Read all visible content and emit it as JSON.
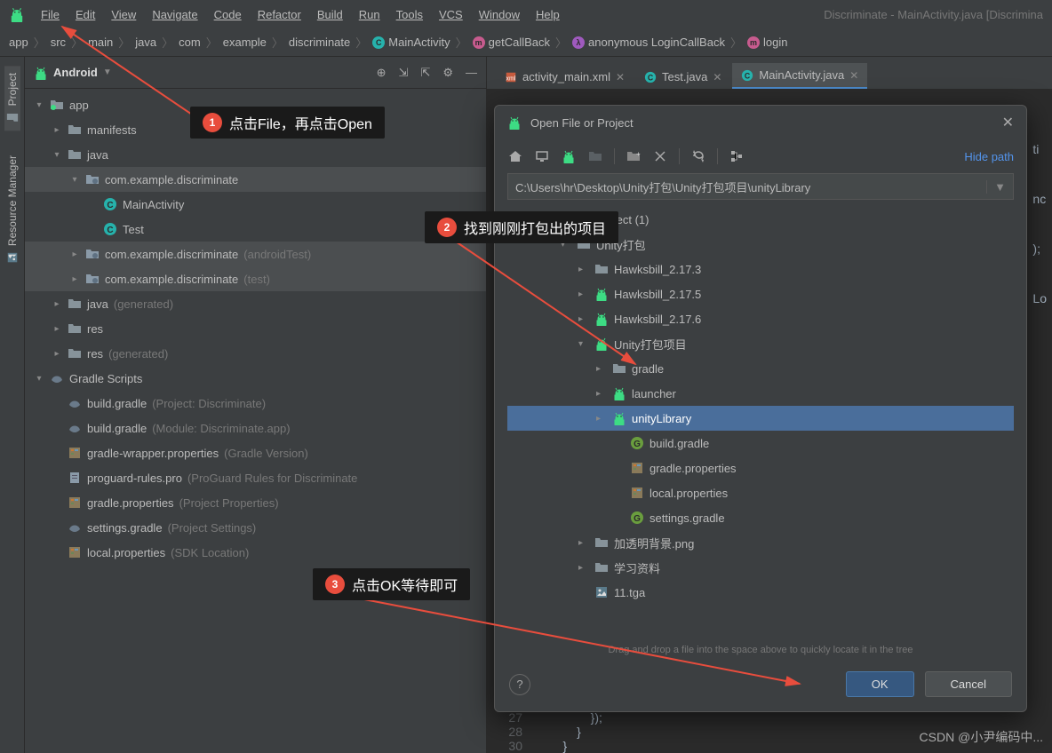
{
  "window": {
    "title": "Discriminate - MainActivity.java [Discrimina"
  },
  "menu": {
    "file": "File",
    "edit": "Edit",
    "view": "View",
    "navigate": "Navigate",
    "code": "Code",
    "refactor": "Refactor",
    "build": "Build",
    "run": "Run",
    "tools": "Tools",
    "vcs": "VCS",
    "window": "Window",
    "help": "Help"
  },
  "breadcrumb": [
    "app",
    "src",
    "main",
    "java",
    "com",
    "example",
    "discriminate",
    "MainActivity",
    "getCallBack",
    "anonymous LoginCallBack",
    "login"
  ],
  "side_tabs": {
    "project": "Project",
    "resource_manager": "Resource Manager"
  },
  "panel": {
    "label": "Android"
  },
  "tree": [
    {
      "indent": 0,
      "arrow": "▾",
      "icon": "module",
      "label": "app",
      "note": "",
      "hl": false
    },
    {
      "indent": 1,
      "arrow": "▸",
      "icon": "folder",
      "label": "manifests",
      "note": "",
      "hl": false
    },
    {
      "indent": 1,
      "arrow": "▾",
      "icon": "folder",
      "label": "java",
      "note": "",
      "hl": false
    },
    {
      "indent": 2,
      "arrow": "▾",
      "icon": "package",
      "label": "com.example.discriminate",
      "note": "",
      "hl": true
    },
    {
      "indent": 3,
      "arrow": "",
      "icon": "class",
      "label": "MainActivity",
      "note": "",
      "hl": false
    },
    {
      "indent": 3,
      "arrow": "",
      "icon": "class",
      "label": "Test",
      "note": "",
      "hl": false
    },
    {
      "indent": 2,
      "arrow": "▸",
      "icon": "package",
      "label": "com.example.discriminate",
      "note": "(androidTest)",
      "hl": true
    },
    {
      "indent": 2,
      "arrow": "▸",
      "icon": "package",
      "label": "com.example.discriminate",
      "note": "(test)",
      "hl": true
    },
    {
      "indent": 1,
      "arrow": "▸",
      "icon": "genfolder",
      "label": "java",
      "note": "(generated)",
      "hl": false
    },
    {
      "indent": 1,
      "arrow": "▸",
      "icon": "resfolder",
      "label": "res",
      "note": "",
      "hl": false
    },
    {
      "indent": 1,
      "arrow": "▸",
      "icon": "resfolder",
      "label": "res",
      "note": "(generated)",
      "hl": false
    },
    {
      "indent": 0,
      "arrow": "▾",
      "icon": "gradle",
      "label": "Gradle Scripts",
      "note": "",
      "hl": false
    },
    {
      "indent": 1,
      "arrow": "",
      "icon": "gradlefile",
      "label": "build.gradle",
      "note": "(Project: Discriminate)",
      "hl": false
    },
    {
      "indent": 1,
      "arrow": "",
      "icon": "gradlefile",
      "label": "build.gradle",
      "note": "(Module: Discriminate.app)",
      "hl": false
    },
    {
      "indent": 1,
      "arrow": "",
      "icon": "propfile",
      "label": "gradle-wrapper.properties",
      "note": "(Gradle Version)",
      "hl": false
    },
    {
      "indent": 1,
      "arrow": "",
      "icon": "textfile",
      "label": "proguard-rules.pro",
      "note": "(ProGuard Rules for Discriminate",
      "hl": false
    },
    {
      "indent": 1,
      "arrow": "",
      "icon": "propfile",
      "label": "gradle.properties",
      "note": "(Project Properties)",
      "hl": false
    },
    {
      "indent": 1,
      "arrow": "",
      "icon": "gradlefile",
      "label": "settings.gradle",
      "note": "(Project Settings)",
      "hl": false
    },
    {
      "indent": 1,
      "arrow": "",
      "icon": "propfile",
      "label": "local.properties",
      "note": "(SDK Location)",
      "hl": false
    }
  ],
  "editor_tabs": [
    {
      "label": "activity_main.xml",
      "icon": "xml",
      "active": false
    },
    {
      "label": "Test.java",
      "icon": "class",
      "active": false
    },
    {
      "label": "MainActivity.java",
      "icon": "class",
      "active": true
    }
  ],
  "editor_lines": [
    {
      "no": "",
      "code": "ti"
    },
    {
      "no": "",
      "code": ""
    },
    {
      "no": "",
      "code": "nc"
    },
    {
      "no": "",
      "code": ""
    },
    {
      "no": "",
      "code": ");"
    },
    {
      "no": "",
      "code": ""
    },
    {
      "no": "",
      "code": ""
    },
    {
      "no": "",
      "code": "Lo"
    },
    {
      "no": "27",
      "code": "            });"
    },
    {
      "no": "28",
      "code": "        }"
    },
    {
      "no": "30",
      "code": "    }"
    }
  ],
  "dialog": {
    "title": "Open File or Project",
    "hide_path": "Hide path",
    "path": "C:\\Users\\hr\\Desktop\\Unity打包\\Unity打包项目\\unityLibrary",
    "hint": "Drag and drop a file into the space above to quickly locate it in the tree",
    "ok": "OK",
    "cancel": "Cancel",
    "tree": [
      {
        "indent": 0,
        "arrow": "▾",
        "icon": "folder",
        "label": "My project (1)",
        "sel": false
      },
      {
        "indent": 1,
        "arrow": "▾",
        "icon": "folder",
        "label": "Unity打包",
        "sel": false
      },
      {
        "indent": 2,
        "arrow": "▸",
        "icon": "folder",
        "label": "Hawksbill_2.17.3",
        "sel": false
      },
      {
        "indent": 2,
        "arrow": "▸",
        "icon": "android",
        "label": "Hawksbill_2.17.5",
        "sel": false
      },
      {
        "indent": 2,
        "arrow": "▸",
        "icon": "android",
        "label": "Hawksbill_2.17.6",
        "sel": false
      },
      {
        "indent": 2,
        "arrow": "▾",
        "icon": "android",
        "label": "Unity打包项目",
        "sel": false
      },
      {
        "indent": 3,
        "arrow": "▸",
        "icon": "folder",
        "label": "gradle",
        "sel": false
      },
      {
        "indent": 3,
        "arrow": "▸",
        "icon": "android",
        "label": "launcher",
        "sel": false
      },
      {
        "indent": 3,
        "arrow": "▸",
        "icon": "android",
        "label": "unityLibrary",
        "sel": true
      },
      {
        "indent": 4,
        "arrow": "",
        "icon": "gcircle",
        "label": "build.gradle",
        "sel": false
      },
      {
        "indent": 4,
        "arrow": "",
        "icon": "propfile",
        "label": "gradle.properties",
        "sel": false
      },
      {
        "indent": 4,
        "arrow": "",
        "icon": "propfile",
        "label": "local.properties",
        "sel": false
      },
      {
        "indent": 4,
        "arrow": "",
        "icon": "gcircle",
        "label": "settings.gradle",
        "sel": false
      },
      {
        "indent": 2,
        "arrow": "▸",
        "icon": "folder",
        "label": "加透明背景.png",
        "sel": false
      },
      {
        "indent": 2,
        "arrow": "▸",
        "icon": "folder",
        "label": "学习资料",
        "sel": false
      },
      {
        "indent": 2,
        "arrow": "",
        "icon": "imgfile",
        "label": "11.tga",
        "sel": false
      }
    ]
  },
  "callouts": {
    "c1": {
      "num": "1",
      "text": "点击File，再点击Open"
    },
    "c2": {
      "num": "2",
      "text": "找到刚刚打包出的项目"
    },
    "c3": {
      "num": "3",
      "text": "点击OK等待即可"
    }
  },
  "watermark": "CSDN @小尹编码中..."
}
